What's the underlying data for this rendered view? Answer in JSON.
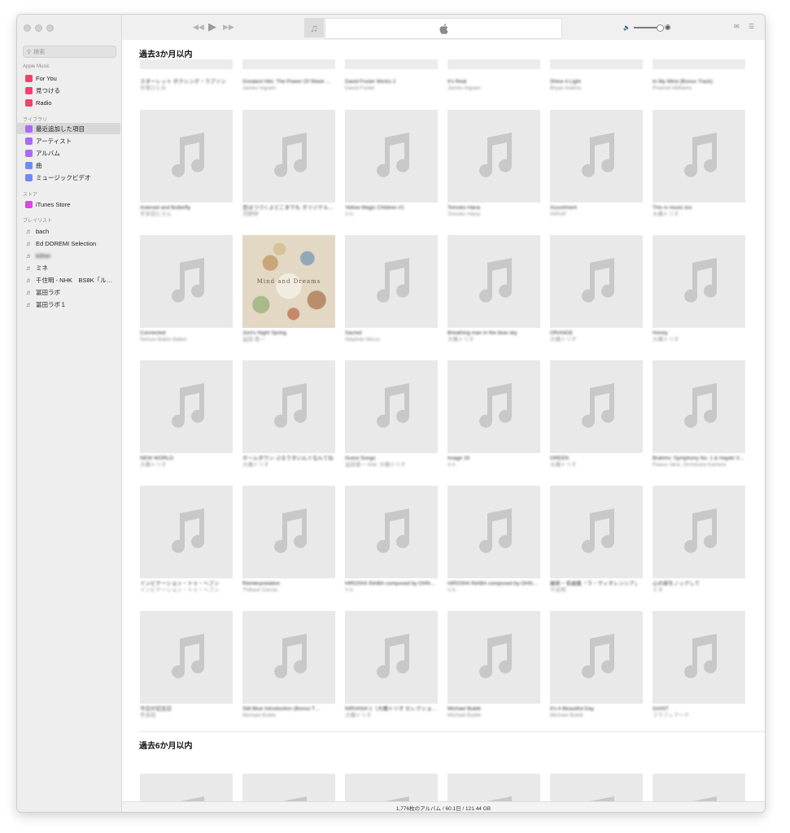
{
  "sidebar": {
    "search_placeholder": "検索",
    "sections": {
      "apple_music": "Apple Music",
      "library": "ライブラリ",
      "store": "ストア",
      "playlists": "プレイリスト"
    },
    "apple_music_items": [
      {
        "label": "For You",
        "icon": "heart-icon",
        "color": "#f0426b"
      },
      {
        "label": "見つける",
        "icon": "music-note-icon",
        "color": "#f0426b"
      },
      {
        "label": "Radio",
        "icon": "radio-icon",
        "color": "#f0426b"
      }
    ],
    "library_items": [
      {
        "label": "最近追加した項目",
        "icon": "clock-icon",
        "color": "#a76cf0"
      },
      {
        "label": "アーティスト",
        "icon": "microphone-icon",
        "color": "#a76cf0"
      },
      {
        "label": "アルバム",
        "icon": "album-icon",
        "color": "#a76cf0"
      },
      {
        "label": "曲",
        "icon": "music-note-icon",
        "color": "#6e8cf0"
      },
      {
        "label": "ミュージックビデオ",
        "icon": "video-icon",
        "color": "#6e8cf0"
      }
    ],
    "store_items": [
      {
        "label": "iTunes Store",
        "icon": "star-icon",
        "color": "#d64adf"
      }
    ],
    "playlist_items": [
      {
        "label": "bach"
      },
      {
        "label": "Ed DOREMI Selection"
      },
      {
        "label": "kōhei"
      },
      {
        "label": "ミネ"
      },
      {
        "label": "千住明 - NHK　BS8K「ル…"
      },
      {
        "label": "冨田ラボ"
      },
      {
        "label": "冨田ラボ１"
      }
    ]
  },
  "toolbar": {
    "prev_icon": "rewind-icon",
    "play_icon": "play-icon",
    "next_icon": "fast-forward-icon"
  },
  "main": {
    "section1_title": "過去3か月以内",
    "section2_title": "過去6か月以内",
    "top_row": [
      {
        "title": "スターレット ボクシング・ラブソン",
        "artist": "手塚ひとみ"
      },
      {
        "title": "Greatest Hits: The Power Of Sheet Music",
        "artist": "James Ingram"
      },
      {
        "title": "David Foster Works 2",
        "artist": "David Foster"
      },
      {
        "title": "It's Real",
        "artist": "James Ingram"
      },
      {
        "title": "Shine A Light",
        "artist": "Bryan Adams"
      },
      {
        "title": "In My Mind (Bonus Track)",
        "artist": "Pharrell Williams"
      }
    ],
    "rows": [
      [
        {
          "title": "Asteroid and Butterfly",
          "artist": "宇多田ヒカル"
        },
        {
          "title": "恋はつづくよどこまでも オリジナル・サウンドトラック",
          "artist": "河野伸"
        },
        {
          "title": "Yellow Magic Children #1",
          "artist": "V.A."
        },
        {
          "title": "Tomoko Hana",
          "artist": "Tomoko Hana"
        },
        {
          "title": "Assortment",
          "artist": "SIRUP"
        },
        {
          "title": "This is music too",
          "artist": "大橋トリオ"
        }
      ],
      [
        {
          "title": "Connected",
          "artist": "Nelson Babin-Baker"
        },
        {
          "title": "Joni's Night Spring",
          "artist": "冨田 恵一"
        },
        {
          "title": "Sacred",
          "artist": "Stephan Micus"
        },
        {
          "title": "Breathing man in the blue sky",
          "artist": "大橋トリオ"
        },
        {
          "title": "ORANGE",
          "artist": "大橋トリオ"
        },
        {
          "title": "Honey",
          "artist": "大橋トリオ"
        }
      ],
      [
        {
          "title": "NEW WORLD",
          "artist": "大橋トリオ"
        },
        {
          "title": "ホームタウン ぶるうすいんぐなんてね",
          "artist": "大橋トリオ"
        },
        {
          "title": "Guest Songs",
          "artist": "冨田恵一 feat. 大橋トリオ"
        },
        {
          "title": "Image 16",
          "artist": "V.A."
        },
        {
          "title": "GREEN",
          "artist": "大橋トリオ"
        },
        {
          "title": "Brahms: Symphony No. 1 & Haydn Variations",
          "artist": "Paavo Järvi, Orchestra Kamera"
        }
      ],
      [
        {
          "title": "インビテーション・トゥ・ヘブン",
          "artist": "インビテーション・トゥ・ヘブン"
        },
        {
          "title": "Reinterpretation",
          "artist": "Thibaut Garcia"
        },
        {
          "title": "HIROSHI INABA composed by OHNUKI KEIKO (Disc 1)",
          "artist": "V.A."
        },
        {
          "title": "HIROSHI INABA composed by OHNUKI KEIKO (Disc 2)",
          "artist": "V.A."
        },
        {
          "title": "最新・名曲集「ラ・ヴィオレンシア」",
          "artist": "千住明"
        },
        {
          "title": "心の扉をノックして",
          "artist": "ミネ"
        }
      ],
      [
        {
          "title": "今日が記念日",
          "artist": "宇多田"
        },
        {
          "title": "Still Blue Introduction (Bonus T…",
          "artist": "Michael Buble"
        },
        {
          "title": "NIRVANA 1（大橋トリオ セレクション）",
          "artist": "大橋トリオ"
        },
        {
          "title": "Michael Bublé",
          "artist": "Michael Bublé"
        },
        {
          "title": "It's A Beautiful Day",
          "artist": "Michael Bublé"
        },
        {
          "title": "GIANT",
          "artist": "ブラフィアーク"
        }
      ]
    ],
    "photo_art_text": "Mind and Dreams"
  },
  "status": {
    "summary": "1,776枚のアルバム / 60.1日 / 121.44 GB"
  }
}
